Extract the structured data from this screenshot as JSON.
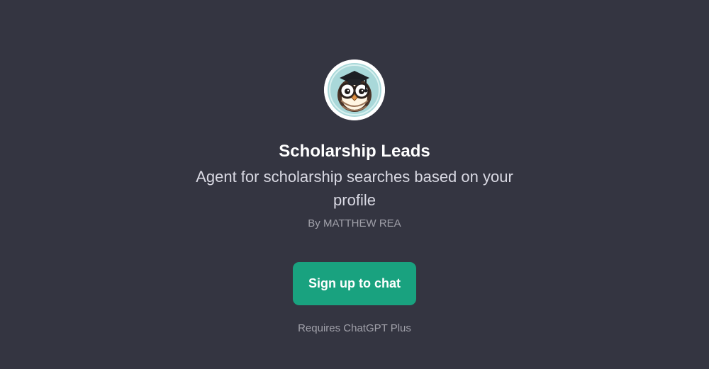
{
  "gpt": {
    "title": "Scholarship Leads",
    "description": "Agent for scholarship searches based on your profile",
    "author": "By MATTHEW REA",
    "avatar_icon": "owl-graduate-icon"
  },
  "actions": {
    "signup_label": "Sign up to chat"
  },
  "footer": {
    "requirement": "Requires ChatGPT Plus"
  },
  "colors": {
    "background": "#343541",
    "button": "#19a27f",
    "avatar_ring": "#a9d8d9",
    "text_primary": "#ffffff",
    "text_secondary": "#d9d9e3",
    "text_muted": "#a1a1aa"
  }
}
